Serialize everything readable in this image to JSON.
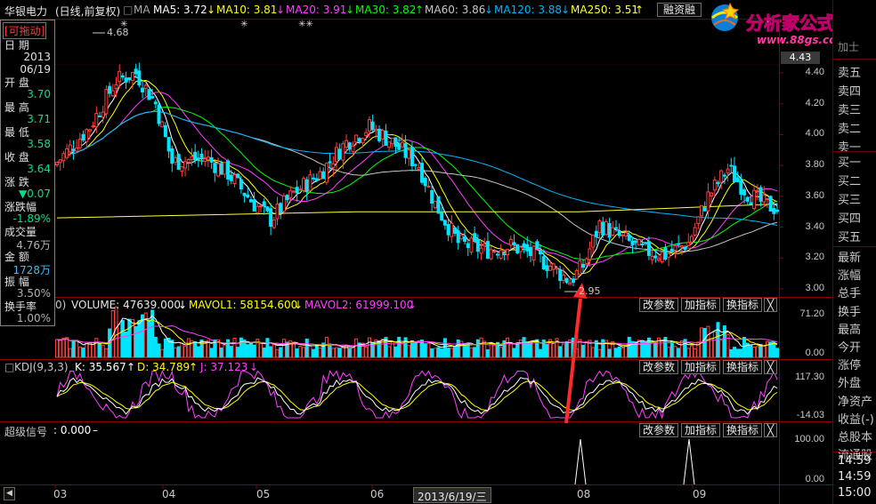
{
  "header": {
    "stock_name": "华银电力",
    "period": "(日线,前复权)",
    "ma_label": "MA",
    "ma5": "MA5: 3.72",
    "ma10": "MA10: 3.81",
    "ma20": "MA20: 3.91",
    "ma30": "MA30: 3.82",
    "ma60": "MA60: 3.86",
    "ma120": "MA120: 3.88",
    "ma250": "MA250: 3.51",
    "tab_label": "融资融"
  },
  "logo": {
    "title": "分析家公式网",
    "url": "www.88gs.com"
  },
  "info_panel": {
    "drag_tag": "[可拖动]",
    "date_label": "日  期",
    "date_year": "2013",
    "date_md": "06/19",
    "open_label": "开  盘",
    "open_val": "3.70",
    "high_label": "最  高",
    "high_val": "3.71",
    "low_label": "最  低",
    "low_val": "3.58",
    "close_label": "收  盘",
    "close_val": "3.64",
    "change_label": "涨  跌",
    "change_val": "▼0.07",
    "pct_label": "涨跌幅",
    "pct_val": "-1.89%",
    "volume_label": "成交量",
    "volume_val": "4.76万",
    "amount_label": "金  额",
    "amount_val": "1728万",
    "amplitude_label": "振  幅",
    "amplitude_val": "3.50%",
    "turnover_label": "换手率",
    "turnover_val": "1.00%"
  },
  "price_panel": {
    "current_price": "4.43",
    "high_marker": "4.68",
    "low_marker": "2.95",
    "ticks": [
      "4.40",
      "4.20",
      "4.00",
      "3.80",
      "3.60",
      "3.40",
      "3.20",
      "3.00"
    ]
  },
  "volume_panel": {
    "title": "0)",
    "volume": "VOLUME: 47639.000",
    "mavol1": "MAVOL1: 58154.600",
    "mavol2": "MAVOL2: 61999.100",
    "ticks": [
      "71.20",
      "0.00"
    ]
  },
  "kdj_panel": {
    "title": "KDJ(9,3,3)",
    "k": "K: 35.567",
    "d": "D: 34.789",
    "j": "J: 37.123",
    "ticks": [
      "117.30",
      "-14.03"
    ]
  },
  "signal_panel": {
    "title": "超级信号",
    "value": ": 0.000",
    "ticks": [
      "100.00",
      "0.00"
    ]
  },
  "buttons": {
    "params": "改参数",
    "add": "加指标",
    "swap": "换指标",
    "close": "╳"
  },
  "x_axis": {
    "labels": [
      "03",
      "04",
      "05",
      "06",
      "08",
      "09"
    ],
    "cursor_date": "2013/6/19/三"
  },
  "right_panel": {
    "sell": [
      "卖五",
      "卖四",
      "卖三",
      "卖二",
      "卖一"
    ],
    "buy": [
      "买一",
      "买二",
      "买三",
      "买四",
      "买五"
    ],
    "stats": [
      "最新",
      "涨幅",
      "总手",
      "换手",
      "最高",
      "今开",
      "涨停",
      "外盘",
      "净资产",
      "收益(-)",
      "总股本",
      "流通股"
    ],
    "times": [
      "14:59",
      "14:59",
      "15:00"
    ],
    "partial_top": "加士"
  },
  "colors": {
    "ma5": "#ffffff",
    "ma10": "#ffff00",
    "ma20": "#ff40ff",
    "ma30": "#00ff00",
    "ma60": "#c8c8c8",
    "ma120": "#00b4ff",
    "ma250": "#ffff40",
    "up": "#ff4040",
    "down": "#00e5ff",
    "grid": "#8b0000",
    "arrow": "#ff2a2a"
  }
}
